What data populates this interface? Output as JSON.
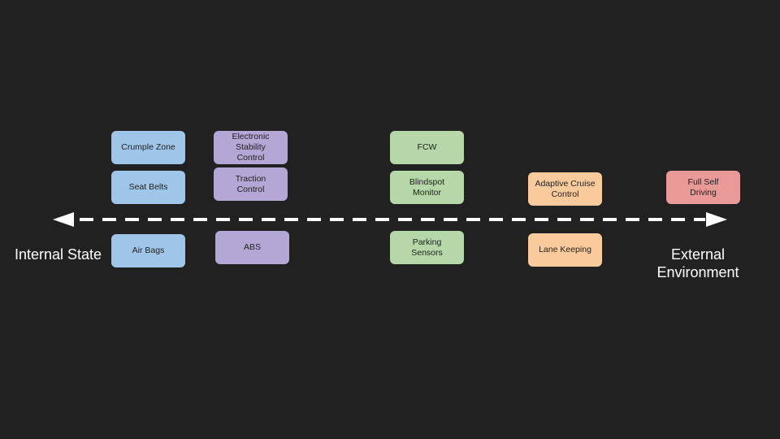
{
  "colors": {
    "background": "#212121",
    "passive": "#9fc5e8",
    "stability": "#b4a7d6",
    "warning": "#b6d7a8",
    "assist": "#f9cb9c",
    "autonomy": "#ea9999",
    "arrow": "#ffffff"
  },
  "axis": {
    "left_label": "Internal State",
    "right_label_line1": "External",
    "right_label_line2": "Environment",
    "arrow_style": "dashed, double-headed"
  },
  "boxes": [
    {
      "label": "Crumple Zone",
      "group": "passive"
    },
    {
      "label": "Seat Belts",
      "group": "passive"
    },
    {
      "label": "Air Bags",
      "group": "passive"
    },
    {
      "label": "Electronic Stability Control",
      "group": "stability"
    },
    {
      "label": "Traction Control",
      "group": "stability"
    },
    {
      "label": "ABS",
      "group": "stability"
    },
    {
      "label": "FCW",
      "group": "warning"
    },
    {
      "label": "Blindspot Monitor",
      "group": "warning"
    },
    {
      "label": "Parking Sensors",
      "group": "warning"
    },
    {
      "label": "Adaptive Cruise Control",
      "group": "assist"
    },
    {
      "label": "Lane Keeping",
      "group": "assist"
    },
    {
      "label": "Full Self Driving",
      "group": "autonomy"
    }
  ]
}
